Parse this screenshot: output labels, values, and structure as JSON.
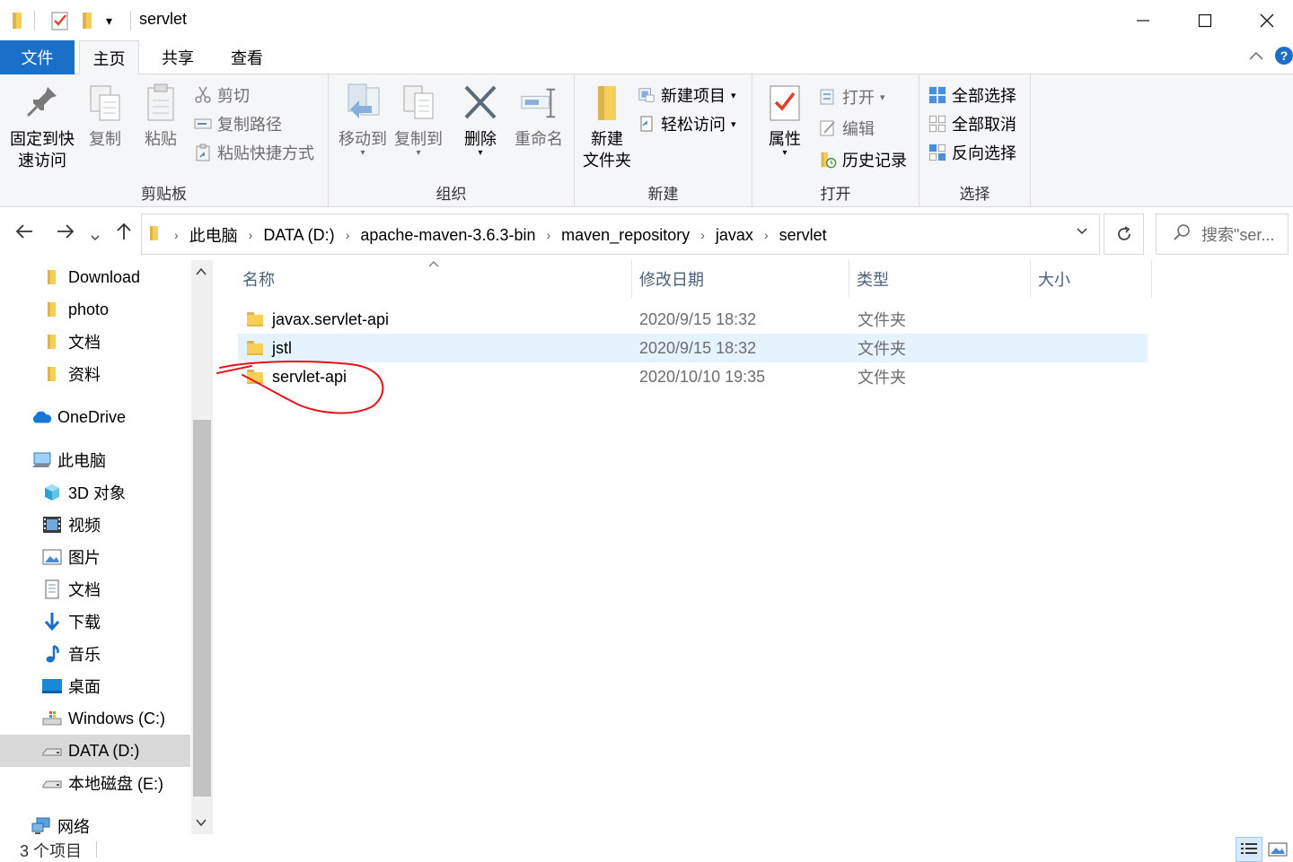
{
  "window": {
    "title": "servlet",
    "minimize": "—",
    "maximize": "☐",
    "close": "✕"
  },
  "tabs": [
    {
      "label": "文件"
    },
    {
      "label": "主页"
    },
    {
      "label": "共享"
    },
    {
      "label": "查看"
    }
  ],
  "ribbon": {
    "clipboard": {
      "group_label": "剪贴板",
      "pin_line1": "固定到快",
      "pin_line2": "速访问",
      "copy": "复制",
      "paste": "粘贴",
      "cut": "剪切",
      "copy_path": "复制路径",
      "paste_shortcut": "粘贴快捷方式"
    },
    "organize": {
      "group_label": "组织",
      "move_to": "移动到",
      "copy_to": "复制到",
      "delete": "删除",
      "rename": "重命名"
    },
    "new": {
      "group_label": "新建",
      "new_folder_line1": "新建",
      "new_folder_line2": "文件夹",
      "new_item": "新建项目",
      "easy_access": "轻松访问"
    },
    "open": {
      "group_label": "打开",
      "properties": "属性",
      "open": "打开",
      "edit": "编辑",
      "history": "历史记录"
    },
    "select": {
      "group_label": "选择",
      "select_all": "全部选择",
      "select_none": "全部取消",
      "invert": "反向选择"
    }
  },
  "address": {
    "crumbs": [
      "此电脑",
      "DATA (D:)",
      "apache-maven-3.6.3-bin",
      "maven_repository",
      "javax",
      "servlet"
    ],
    "search_placeholder": "搜索\"ser..."
  },
  "nav": {
    "items": [
      {
        "label": "Download",
        "icon": "folder-icon"
      },
      {
        "label": "photo",
        "icon": "folder-icon"
      },
      {
        "label": "文档",
        "icon": "folder-icon"
      },
      {
        "label": "资料",
        "icon": "folder-icon"
      },
      {
        "label": "OneDrive",
        "icon": "cloud-icon"
      },
      {
        "label": "此电脑",
        "icon": "computer-icon"
      },
      {
        "label": "3D 对象",
        "icon": "cube-icon"
      },
      {
        "label": "视频",
        "icon": "video-icon"
      },
      {
        "label": "图片",
        "icon": "picture-icon"
      },
      {
        "label": "文档",
        "icon": "document-icon"
      },
      {
        "label": "下载",
        "icon": "download-icon"
      },
      {
        "label": "音乐",
        "icon": "music-icon"
      },
      {
        "label": "桌面",
        "icon": "desktop-icon"
      },
      {
        "label": "Windows (C:)",
        "icon": "drive-icon"
      },
      {
        "label": "DATA (D:)",
        "icon": "drive-icon"
      },
      {
        "label": "本地磁盘 (E:)",
        "icon": "drive-icon"
      },
      {
        "label": "网络",
        "icon": "network-icon"
      }
    ],
    "selected": "DATA (D:)"
  },
  "columns": {
    "name": "名称",
    "date": "修改日期",
    "type": "类型",
    "size": "大小"
  },
  "files": [
    {
      "name": "javax.servlet-api",
      "date": "2020/9/15 18:32",
      "type": "文件夹"
    },
    {
      "name": "jstl",
      "date": "2020/9/15 18:32",
      "type": "文件夹"
    },
    {
      "name": "servlet-api",
      "date": "2020/10/10 19:35",
      "type": "文件夹"
    }
  ],
  "status": {
    "count": "3 个项目"
  },
  "colors": {
    "accent": "#1a6fc9",
    "hover_row": "#e5f3ff",
    "annotation": "#e8121b"
  }
}
